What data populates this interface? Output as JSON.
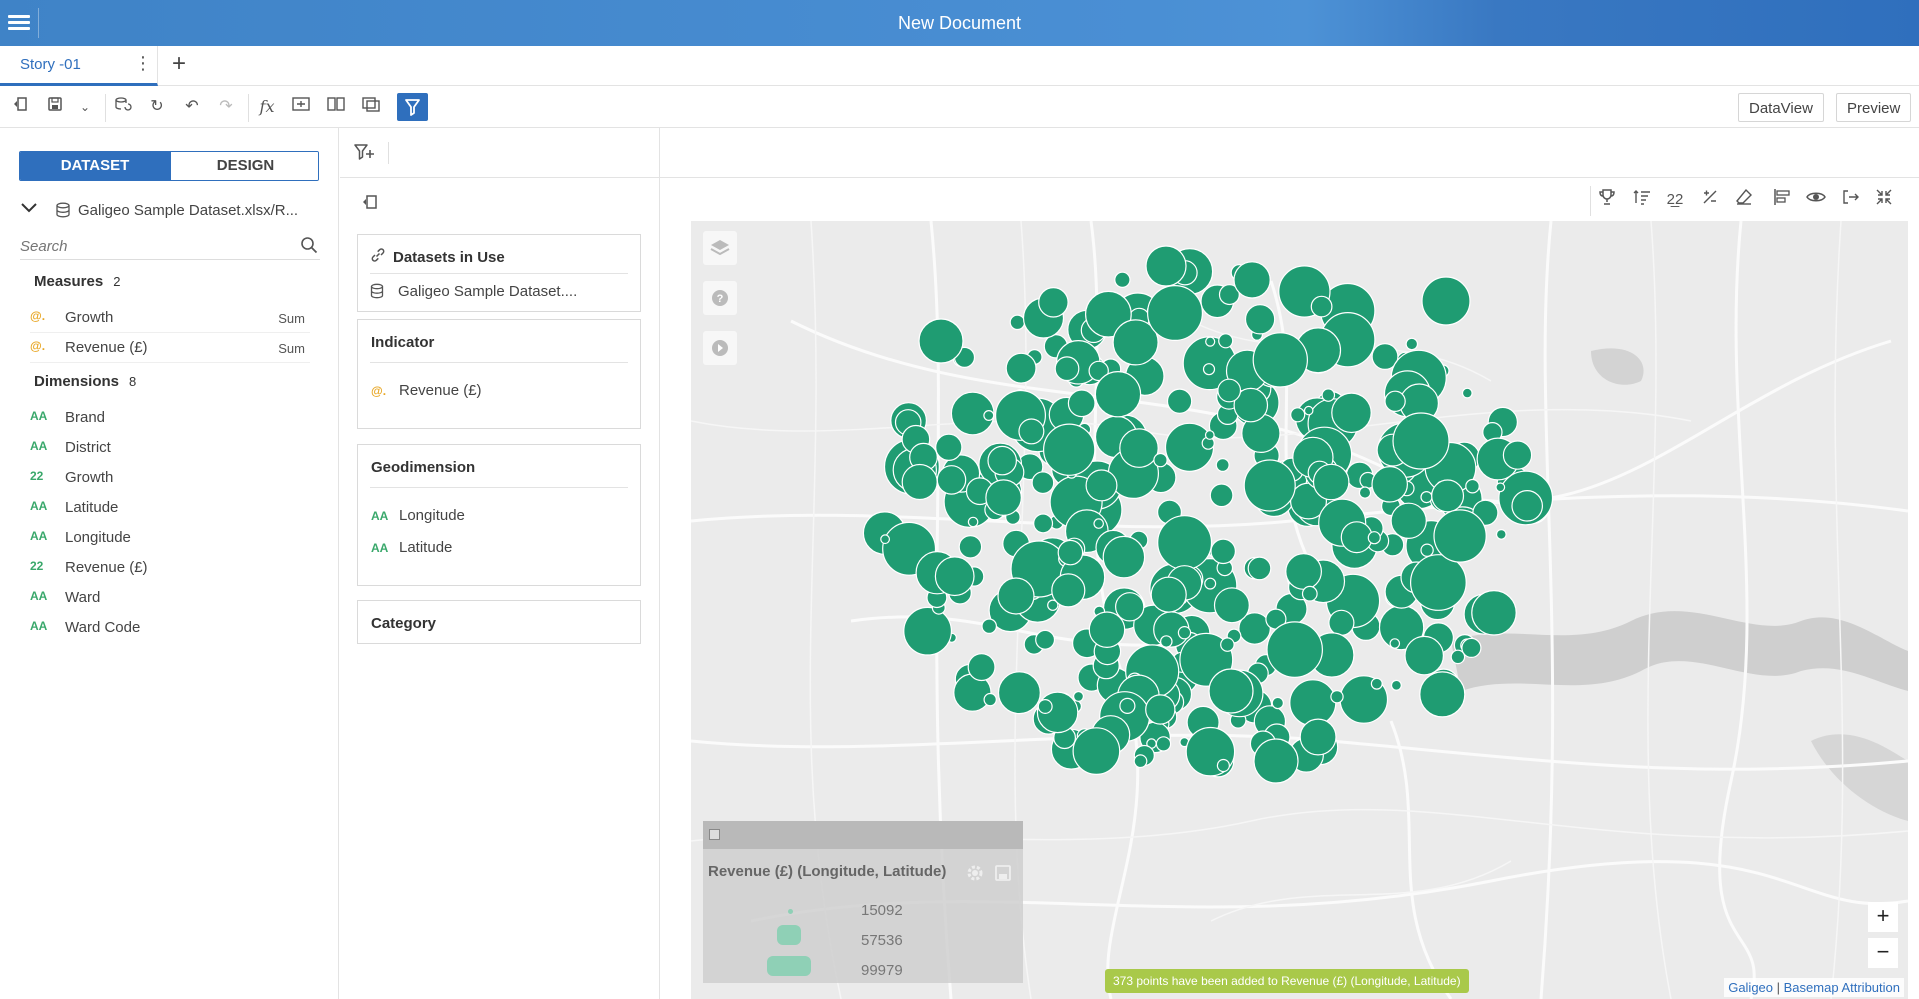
{
  "header": {
    "title": "New Document"
  },
  "tabs": [
    {
      "label": "Story -01"
    }
  ],
  "toolbar": {
    "right_buttons": {
      "dataview": "DataView",
      "preview": "Preview"
    }
  },
  "leftpanel": {
    "segment": {
      "dataset": "DATASET",
      "design": "DESIGN"
    },
    "dataset_name": "Galigeo Sample Dataset.xlsx/R...",
    "search_placeholder": "Search",
    "measures": {
      "header": "Measures",
      "count": "2",
      "items": [
        {
          "label": "Growth",
          "agg": "Sum",
          "icon": "@."
        },
        {
          "label": "Revenue (£)",
          "agg": "Sum",
          "icon": "@."
        }
      ]
    },
    "dimensions": {
      "header": "Dimensions",
      "count": "8",
      "items": [
        {
          "label": "Brand",
          "icon": "AA"
        },
        {
          "label": "District",
          "icon": "AA"
        },
        {
          "label": "Growth",
          "icon": "22"
        },
        {
          "label": "Latitude",
          "icon": "AA"
        },
        {
          "label": "Longitude",
          "icon": "AA"
        },
        {
          "label": "Revenue (£)",
          "icon": "22"
        },
        {
          "label": "Ward",
          "icon": "AA"
        },
        {
          "label": "Ward Code",
          "icon": "AA"
        }
      ]
    }
  },
  "config": {
    "datasets_in_use": {
      "header": "Datasets in Use",
      "item": "Galigeo Sample Dataset...."
    },
    "indicator": {
      "header": "Indicator",
      "item": "Revenue (£)",
      "icon": "@."
    },
    "geodimension": {
      "header": "Geodimension",
      "items": [
        {
          "label": "Longitude",
          "icon": "AA"
        },
        {
          "label": "Latitude",
          "icon": "AA"
        }
      ]
    },
    "category": {
      "header": "Category"
    }
  },
  "map": {
    "legend": {
      "title": "Revenue (£) (Longitude, Latitude)",
      "values": [
        "15092",
        "57536",
        "99979"
      ]
    },
    "toast": "373 points have been added to Revenue (£) (Longitude, Latitude)",
    "attribution": {
      "galigeo": "Galigeo",
      "basemap": "Basemap Attribution"
    },
    "zoom_in": "+",
    "zoom_out": "−",
    "bubble_color": "#1f9c72"
  },
  "colors": {
    "accent": "#2f6fbd",
    "measure": "#e8a726",
    "dimension": "#3aa86b"
  }
}
